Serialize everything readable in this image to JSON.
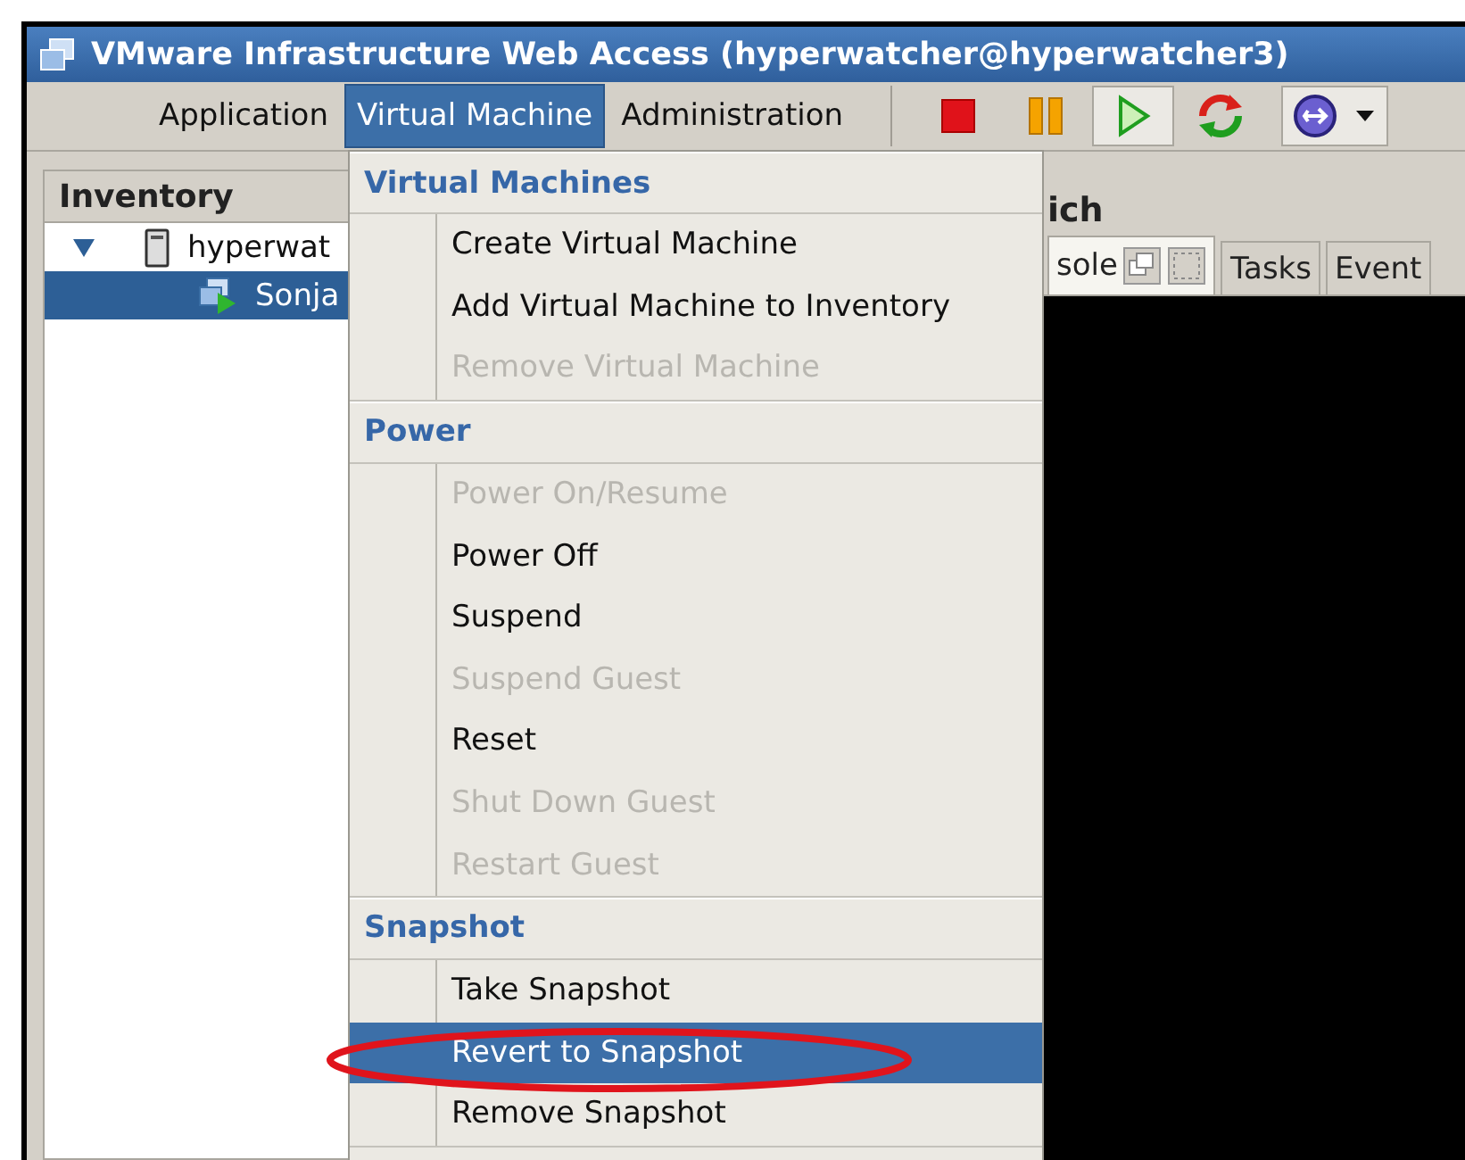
{
  "window": {
    "title": "VMware Infrastructure Web Access (hyperwatcher@hyperwatcher3)"
  },
  "menu_bar": [
    {
      "label": "Application",
      "selected": false
    },
    {
      "label": "Virtual Machine",
      "selected": true
    },
    {
      "label": "Administration",
      "selected": false
    }
  ],
  "toolbar": [
    {
      "kind": "stop",
      "pressed": false
    },
    {
      "kind": "pause",
      "pressed": false
    },
    {
      "kind": "play",
      "pressed": true
    },
    {
      "kind": "reset",
      "pressed": false
    },
    {
      "kind": "console",
      "pressed": true
    }
  ],
  "inventory": {
    "title": "Inventory",
    "tree": [
      {
        "label": "hyperwat",
        "kind": "host",
        "selected": false,
        "expanded": true,
        "children": [
          {
            "label": "Sonja",
            "kind": "vm",
            "selected": true
          }
        ]
      }
    ]
  },
  "detail": {
    "title": "ich",
    "tabs": [
      {
        "label": "sole",
        "selected": true
      },
      {
        "label": "Tasks",
        "selected": false
      },
      {
        "label": "Event",
        "selected": false
      }
    ]
  },
  "dropdown": {
    "sections": [
      {
        "title": "Virtual Machines",
        "items": [
          {
            "label": "Create Virtual Machine",
            "disabled": false,
            "selected": false
          },
          {
            "label": "Add Virtual Machine to Inventory",
            "disabled": false,
            "selected": false
          },
          {
            "label": "Remove Virtual Machine",
            "disabled": true,
            "selected": false
          }
        ]
      },
      {
        "title": "Power",
        "items": [
          {
            "label": "Power On/Resume",
            "disabled": true,
            "selected": false
          },
          {
            "label": "Power Off",
            "disabled": false,
            "selected": false
          },
          {
            "label": "Suspend",
            "disabled": false,
            "selected": false
          },
          {
            "label": "Suspend Guest",
            "disabled": true,
            "selected": false
          },
          {
            "label": "Reset",
            "disabled": false,
            "selected": false
          },
          {
            "label": "Shut Down Guest",
            "disabled": true,
            "selected": false
          },
          {
            "label": "Restart Guest",
            "disabled": true,
            "selected": false
          }
        ]
      },
      {
        "title": "Snapshot",
        "items": [
          {
            "label": "Take Snapshot",
            "disabled": false,
            "selected": false
          },
          {
            "label": "Revert to Snapshot",
            "disabled": false,
            "selected": true
          },
          {
            "label": "Remove Snapshot",
            "disabled": false,
            "selected": false
          }
        ]
      }
    ]
  }
}
